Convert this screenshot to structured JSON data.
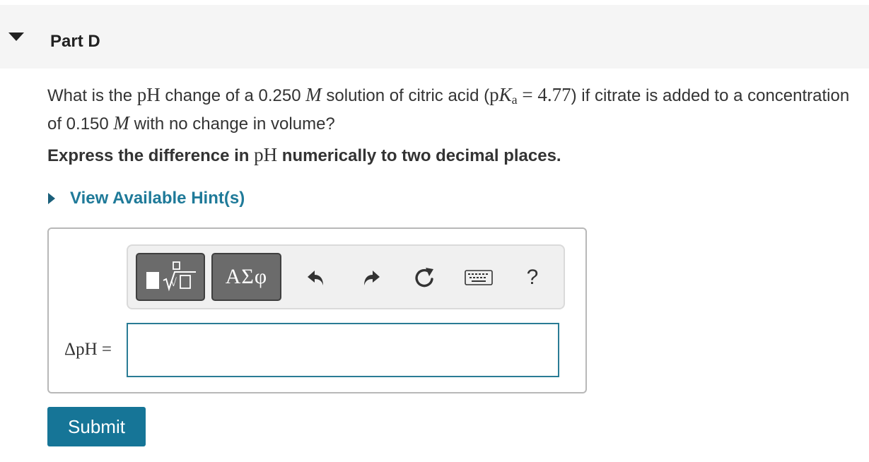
{
  "part": {
    "title": "Part D"
  },
  "question": {
    "t1": "What is the ",
    "m_ph": "pH",
    "t2": " change of a 0.250 ",
    "m_M1": "M",
    "t3": " solution of citric acid (",
    "m_pka_p": "p",
    "m_pka_K": "K",
    "m_pka_sub": "a",
    "m_pka_eq": " = 4.77",
    "t4": ") if citrate is added to a concentration of 0.150 ",
    "m_M2": "M",
    "t5": " with no change in volume?"
  },
  "instruction": {
    "t1": "Express the difference in ",
    "m_ph": "pH",
    "t2": " numerically to two decimal places."
  },
  "hint": {
    "label": "View Available Hint(s)"
  },
  "toolbar": {
    "templates_icon": "templates-icon",
    "symbols_label": "ΑΣφ",
    "undo_icon": "undo-icon",
    "redo_icon": "redo-icon",
    "reset_icon": "reset-icon",
    "keyboard_icon": "keyboard-icon",
    "help_label": "?"
  },
  "answer": {
    "label": "ΔpH =",
    "value": "",
    "placeholder": ""
  },
  "submit": {
    "label": "Submit"
  },
  "colors": {
    "accent": "#167597",
    "link": "#1f7a99",
    "header_bg": "#f5f5f5",
    "toolbar_button": "#6b6b6b"
  }
}
